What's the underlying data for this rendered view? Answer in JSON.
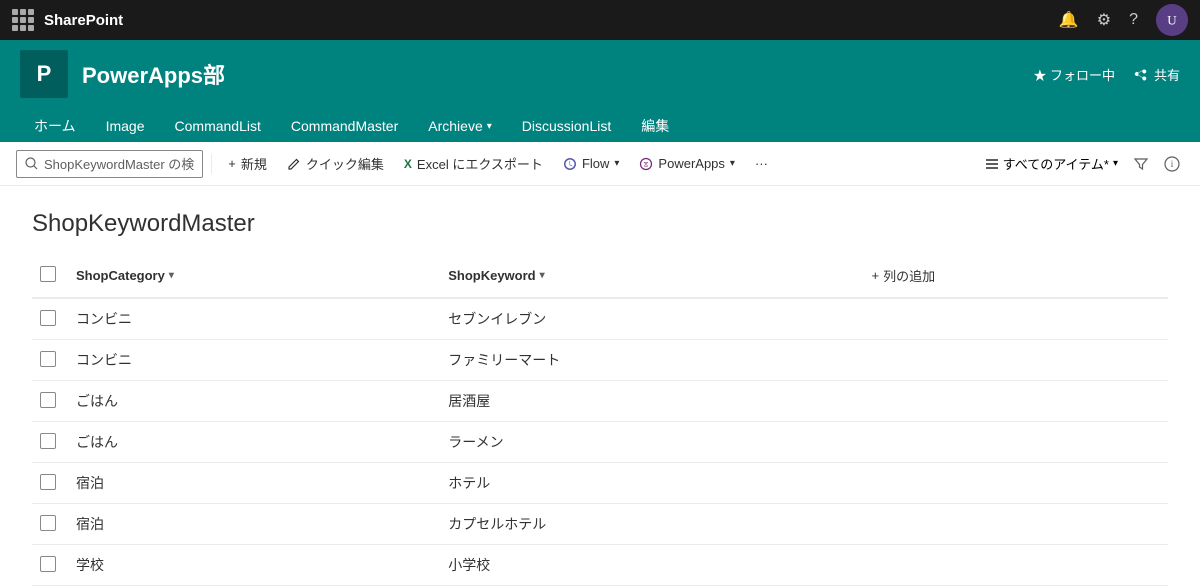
{
  "topnav": {
    "brand": "SharePoint",
    "icons": {
      "bell": "🔔",
      "settings": "⚙",
      "help": "?",
      "avatar_text": "U"
    }
  },
  "siteheader": {
    "logo_letter": "P",
    "title": "PowerApps部",
    "actions": {
      "follow": "★ フォロー中",
      "share": "共有"
    },
    "nav": [
      {
        "label": "ホーム",
        "has_dropdown": false
      },
      {
        "label": "Image",
        "has_dropdown": false
      },
      {
        "label": "CommandList",
        "has_dropdown": false
      },
      {
        "label": "CommandMaster",
        "has_dropdown": false
      },
      {
        "label": "Archieve",
        "has_dropdown": true
      },
      {
        "label": "DiscussionList",
        "has_dropdown": false
      },
      {
        "label": "編集",
        "has_dropdown": false
      }
    ]
  },
  "commandbar": {
    "search_placeholder": "ShopKeywordMaster の検",
    "buttons": [
      {
        "label": "+ 新規",
        "icon": ""
      },
      {
        "label": "✎ クイック編集",
        "icon": ""
      },
      {
        "label": "Excel にエクスポート",
        "icon": "xl"
      },
      {
        "label": "Flow",
        "icon": "flow",
        "has_dropdown": true
      },
      {
        "label": "PowerApps",
        "icon": "pa",
        "has_dropdown": true
      },
      {
        "label": "...",
        "icon": ""
      }
    ],
    "right": {
      "view": "すべてのアイテム*",
      "filter": "フィルター",
      "info": "情報"
    }
  },
  "page": {
    "title": "ShopKeywordMaster"
  },
  "table": {
    "columns": [
      {
        "label": "ShopCategory",
        "has_sort": true
      },
      {
        "label": "ShopKeyword",
        "has_sort": true
      },
      {
        "label": "+ 列の追加",
        "is_add": true
      }
    ],
    "rows": [
      {
        "category": "コンビニ",
        "keyword": "セブンイレブン"
      },
      {
        "category": "コンビニ",
        "keyword": "ファミリーマート"
      },
      {
        "category": "ごはん",
        "keyword": "居酒屋"
      },
      {
        "category": "ごはん",
        "keyword": "ラーメン"
      },
      {
        "category": "宿泊",
        "keyword": "ホテル"
      },
      {
        "category": "宿泊",
        "keyword": "カプセルホテル"
      },
      {
        "category": "学校",
        "keyword": "小学校"
      }
    ]
  }
}
